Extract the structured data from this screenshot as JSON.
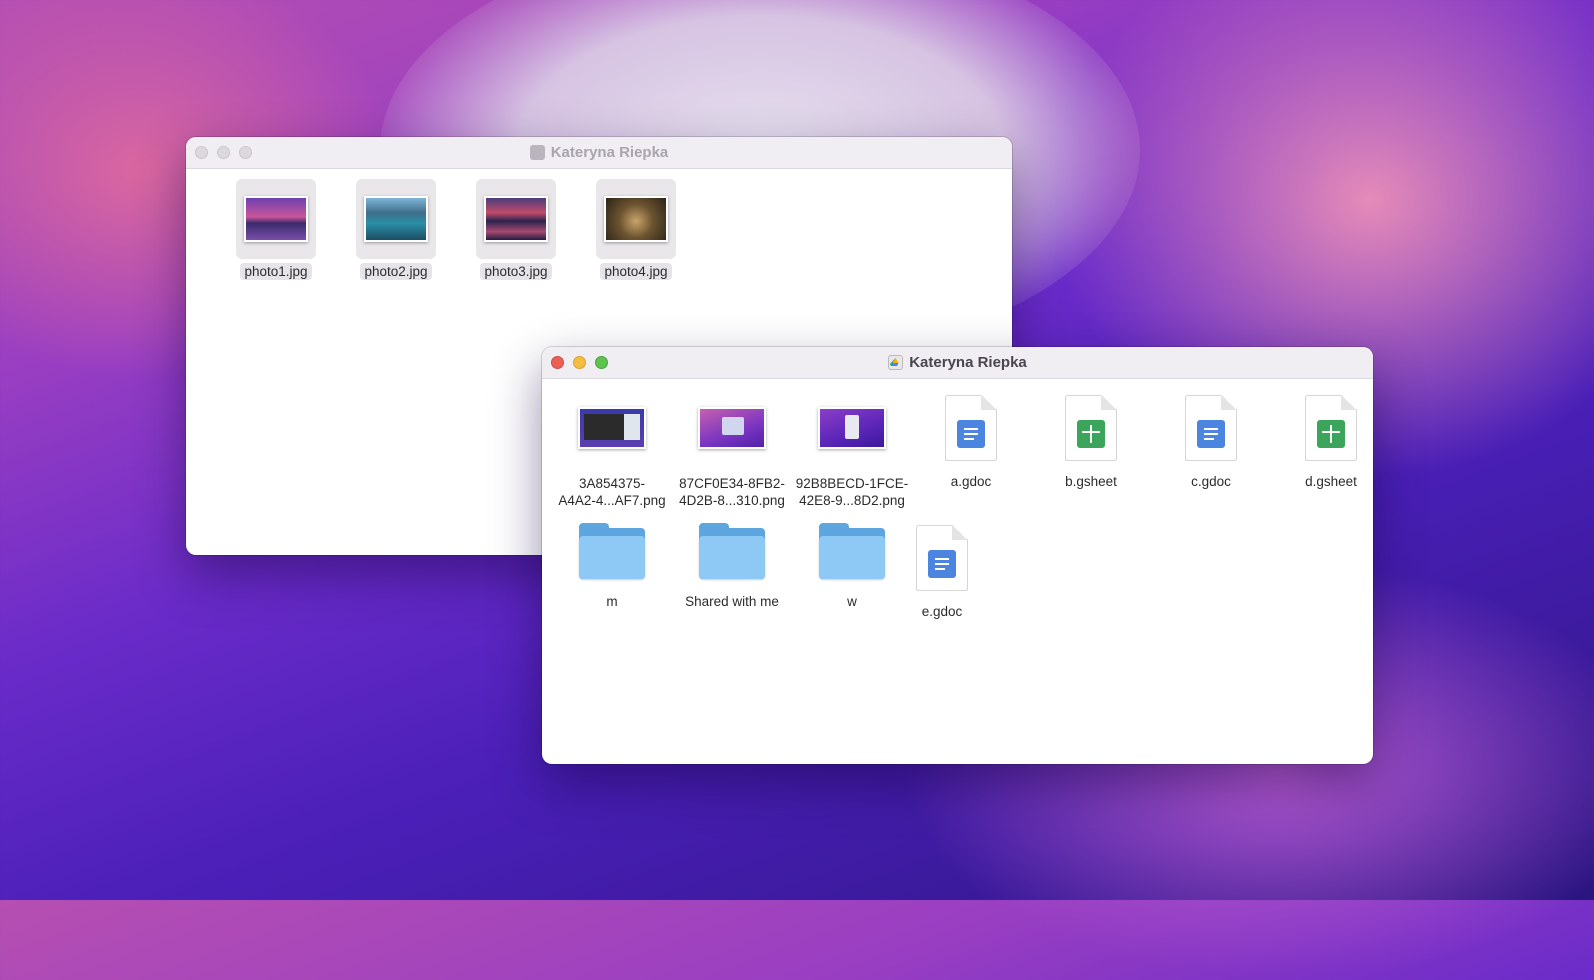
{
  "colors": {
    "wallpaper_top": "#b64fb2",
    "wallpaper_bottom": "#2a1580",
    "gdoc_blue": "#4b85e0",
    "gsheet_green": "#3ba55c",
    "folder_blue": "#8ec9f5"
  },
  "back_window": {
    "title": "Kateryna Riepka",
    "title_icon": "drive-download-icon",
    "files": [
      {
        "name": "photo1.jpg",
        "icon": "image-icon"
      },
      {
        "name": "photo2.jpg",
        "icon": "image-icon"
      },
      {
        "name": "photo3.jpg",
        "icon": "image-icon"
      },
      {
        "name": "photo4.jpg",
        "icon": "image-icon"
      }
    ]
  },
  "front_window": {
    "title": "Kateryna Riepka",
    "title_icon": "google-drive-icon",
    "files": [
      {
        "name": "3A854375-\nA4A2-4...AF7.png",
        "icon": "screenshot-icon"
      },
      {
        "name": "87CF0E34-8FB2-\n4D2B-8...310.png",
        "icon": "screenshot-icon"
      },
      {
        "name": "92B8BECD-1FCE-\n42E8-9...8D2.png",
        "icon": "screenshot-icon"
      },
      {
        "name": "a.gdoc",
        "icon": "google-doc-icon"
      },
      {
        "name": "b.gsheet",
        "icon": "google-sheet-icon"
      },
      {
        "name": "c.gdoc",
        "icon": "google-doc-icon"
      },
      {
        "name": "d.gsheet",
        "icon": "google-sheet-icon"
      },
      {
        "name": "m",
        "icon": "folder-icon"
      },
      {
        "name": "Shared with me",
        "icon": "folder-icon"
      },
      {
        "name": "w",
        "icon": "folder-icon"
      },
      {
        "name": "e.gdoc",
        "icon": "google-doc-icon"
      }
    ]
  }
}
